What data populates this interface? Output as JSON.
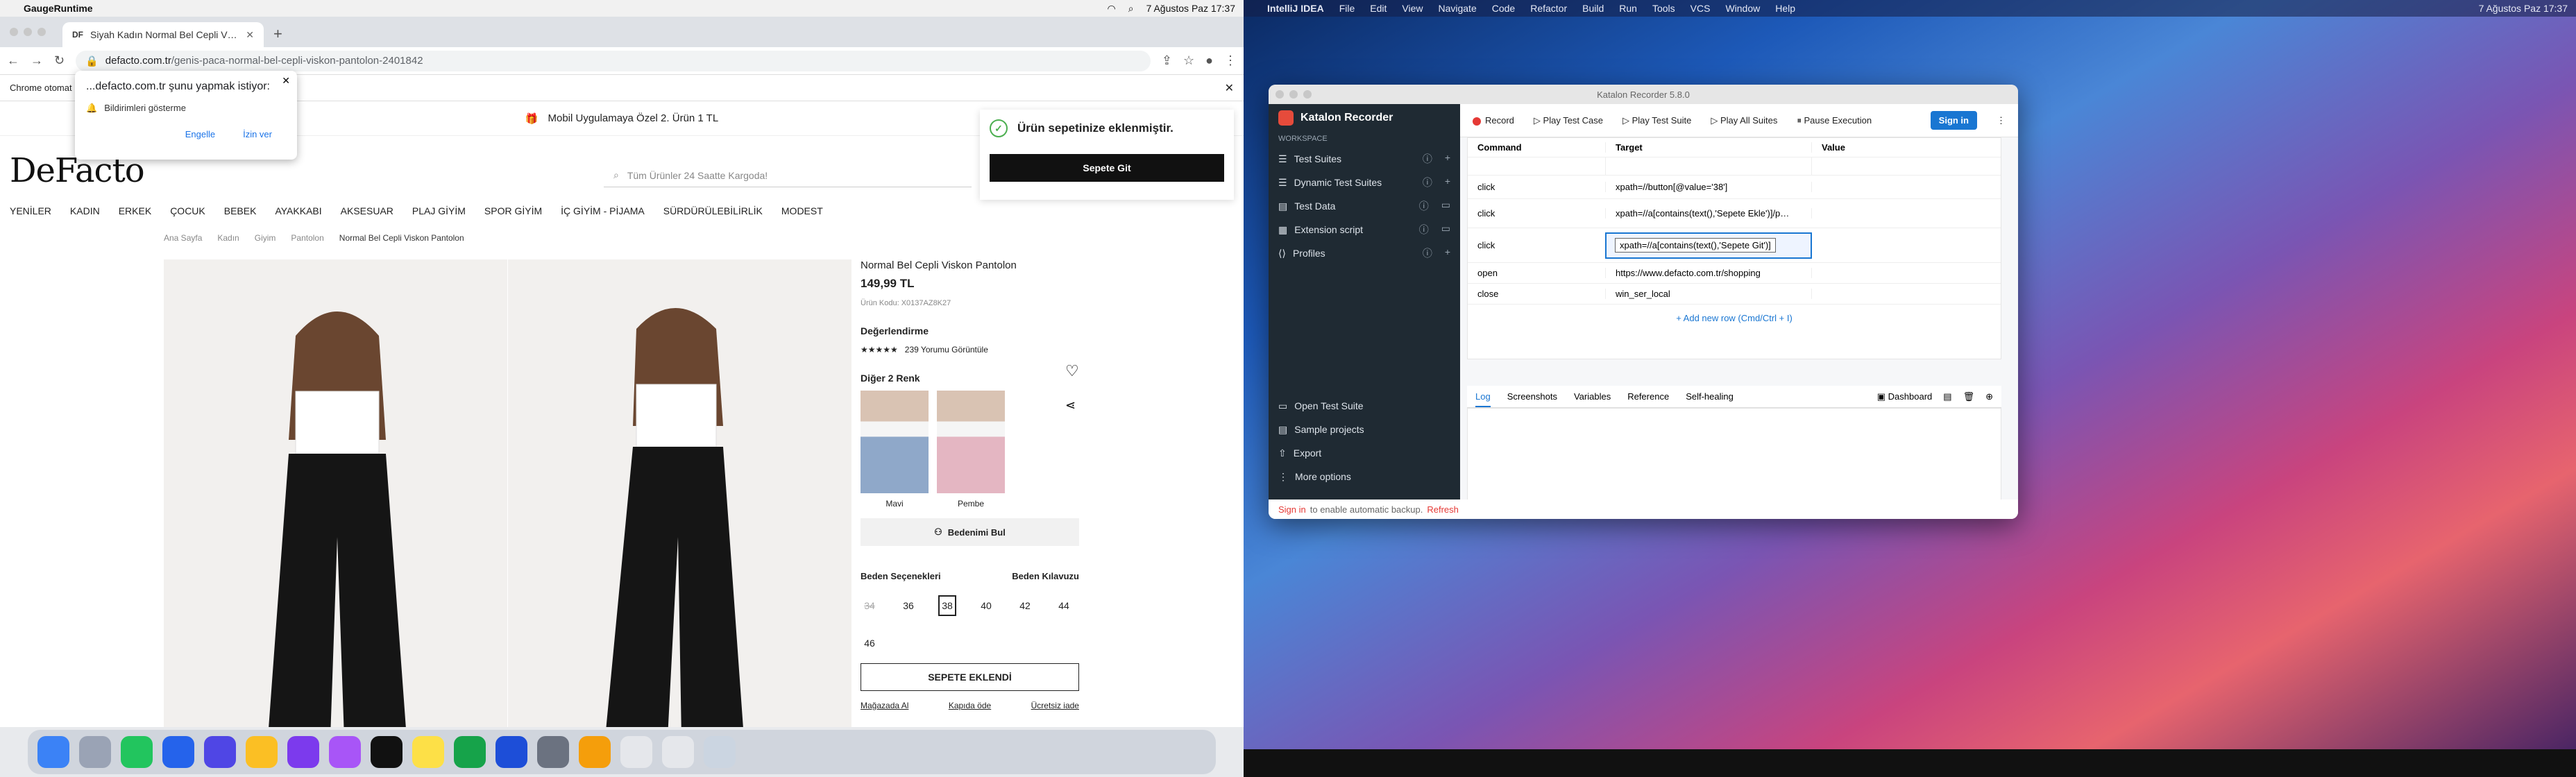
{
  "left": {
    "menubar": {
      "app": "GaugeRuntime",
      "clock": "7 Ağustos Paz  17:37"
    },
    "tab": {
      "favicon": "DF",
      "title": "Siyah Kadın Normal Bel Cepli V…"
    },
    "url": {
      "host": "defacto.com.tr",
      "path": "/genis-paca-normal-bel-cepli-viskon-pantolon-2401842"
    },
    "infobar": "Chrome otomat",
    "notify": {
      "title": "...defacto.com.tr şunu yapmak istiyor:",
      "line": "Bildirimleri gösterme",
      "block": "Engelle",
      "allow": "İzin ver"
    },
    "promo": "Mobil Uygulamaya Özel 2. Ürün 1 TL",
    "logo": "DeFacto",
    "search_placeholder": "Tüm Ürünler 24 Saatte Kargoda!",
    "nav": [
      "YENİLER",
      "KADIN",
      "ERKEK",
      "ÇOCUK",
      "BEBEK",
      "AYAKKABI",
      "AKSESUAR",
      "PLAJ GİYİM",
      "SPOR GİYİM",
      "İÇ GİYİM - PİJAMA",
      "SÜRDÜRÜLEBİLİRLİK",
      "MODEST"
    ],
    "crumbs": [
      "Ana Sayfa",
      "Kadın",
      "Giyim",
      "Pantolon",
      "Normal Bel Cepli Viskon Pantolon"
    ],
    "toast": {
      "message": "Ürün sepetinize eklenmiştir.",
      "button": "Sepete Git"
    },
    "product": {
      "name": "Normal Bel Cepli Viskon Pantolon",
      "price": "149,99 TL",
      "code": "Ürün Kodu: X0137AZ8K27",
      "rating_title": "Değerlendirme",
      "reviews": "239 Yorumu Görüntüle",
      "colors_title": "Diğer 2 Renk",
      "colors": [
        "Mavi",
        "Pembe"
      ],
      "fit_button": "Bedenimi Bul",
      "sizes_title": "Beden Seçenekleri",
      "size_guide": "Beden Kılavuzu",
      "sizes": [
        "34",
        "36",
        "38",
        "40",
        "42",
        "44",
        "46"
      ],
      "add_button": "SEPETE EKLENDİ",
      "links": [
        "Mağazada Al",
        "Kapıda öde",
        "Ücretsiz iade"
      ]
    }
  },
  "right": {
    "menubar": {
      "app": "IntelliJ IDEA",
      "items": [
        "File",
        "Edit",
        "View",
        "Navigate",
        "Code",
        "Refactor",
        "Build",
        "Run",
        "Tools",
        "VCS",
        "Window",
        "Help"
      ],
      "clock": "7 Ağustos Paz  17:37"
    },
    "katalon": {
      "title": "Katalon Recorder 5.8.0",
      "brand": "Katalon Recorder",
      "workspace": "WORKSPACE",
      "side": [
        "Test Suites",
        "Dynamic Test Suites",
        "Test Data",
        "Extension script",
        "Profiles"
      ],
      "bottom": [
        "Open Test Suite",
        "Sample projects",
        "Export",
        "More options"
      ],
      "toolbar": [
        "Record",
        "Play Test Case",
        "Play Test Suite",
        "Play All Suites",
        "Pause Execution"
      ],
      "sign_in": "Sign in",
      "headers": [
        "Command",
        "Target",
        "Value"
      ],
      "rows": [
        {
          "cmd": "click",
          "target": "xpath=//button[@value='38']",
          "value": ""
        },
        {
          "cmd": "click",
          "target": "xpath=//a[contains(text(),'Sepete Ekle')]/p…",
          "value": ""
        },
        {
          "cmd": "click",
          "target": "xpath=//a[contains(text(),'Sepete Git')]",
          "value": ""
        },
        {
          "cmd": "open",
          "target": "https://www.defacto.com.tr/shopping",
          "value": ""
        },
        {
          "cmd": "close",
          "target": "win_ser_local",
          "value": ""
        }
      ],
      "add_row": "+ Add new row (Cmd/Ctrl + I)",
      "tabs": [
        "Log",
        "Screenshots",
        "Variables",
        "Reference",
        "Self-healing"
      ],
      "dashboard": "Dashboard",
      "status_link": "Sign in",
      "status_text": "to enable automatic backup.",
      "status_refresh": "Refresh"
    }
  }
}
